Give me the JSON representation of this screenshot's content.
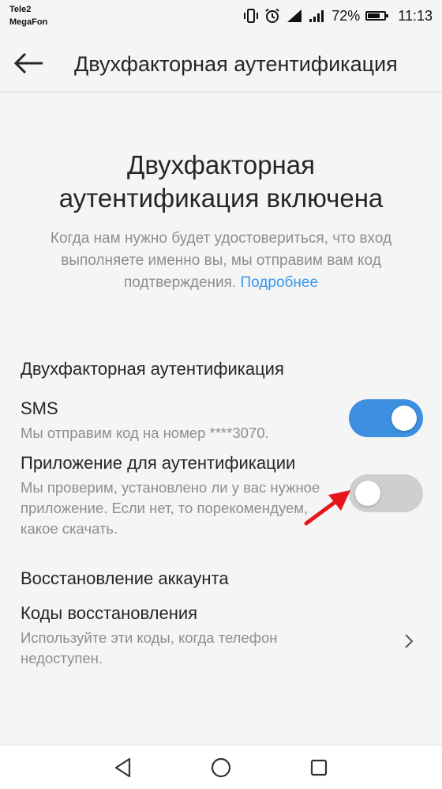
{
  "status_bar": {
    "carrier1": "Tele2",
    "carrier2": "MegaFon",
    "battery_percent": "72%",
    "battery_level": 0.72,
    "time": "11:13",
    "icons": [
      "vibrate-icon",
      "alarm-icon",
      "signal-icon",
      "wifi-signal-icon",
      "battery-icon"
    ]
  },
  "header": {
    "title": "Двухфакторная аутентификация"
  },
  "hero": {
    "title_line1": "Двухфакторная",
    "title_line2": "аутентификация включена",
    "description": "Когда нам нужно будет удостовериться, что вход выполняете именно вы, мы отправим вам код подтверждения.",
    "learn_more": "Подробнее"
  },
  "two_factor": {
    "section_title": "Двухфакторная аутентификация",
    "sms": {
      "title": "SMS",
      "description": "Мы отправим код на номер ****3070.",
      "enabled": true
    },
    "auth_app": {
      "title": "Приложение для аутентификации",
      "description": "Мы проверим, установлено ли у вас нужное приложение. Если нет, то порекомендуем, какое скачать.",
      "enabled": false
    }
  },
  "recovery": {
    "section_title": "Восстановление аккаунта",
    "codes_title": "Коды восстановления",
    "codes_description": "Используйте эти коды, когда телефон недоступен."
  },
  "colors": {
    "toggle_on": "#3d8fe0",
    "toggle_off": "#cfcfcf",
    "link": "#3897f0",
    "annotation_arrow": "#e8141c"
  }
}
